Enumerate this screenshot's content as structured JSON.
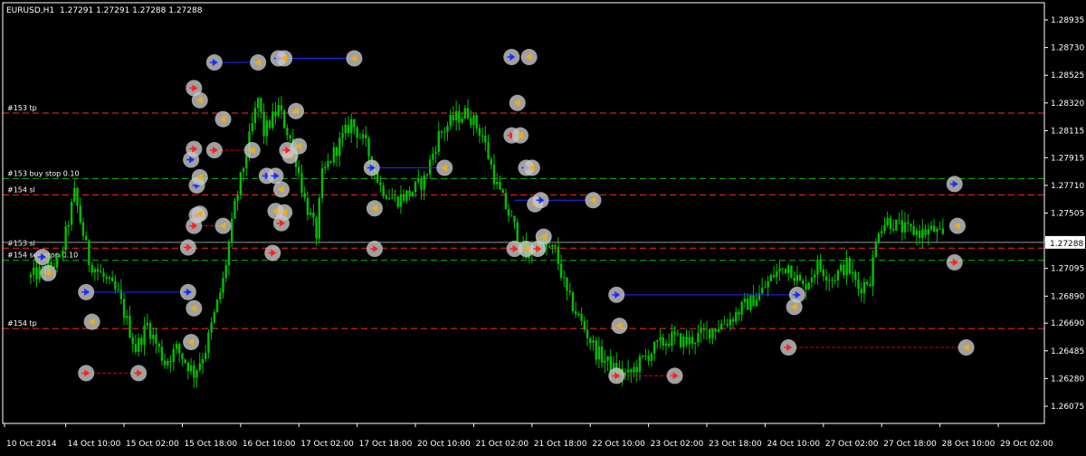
{
  "header": {
    "symbol": "EURUSD,H1",
    "ohlc": "1.27291 1.27291 1.27288 1.27288"
  },
  "colors": {
    "background": "#000000",
    "frame": "#ffffff",
    "grid": "#6b6b6b",
    "candle": "#00c000",
    "price_marker_bg": "#ffffff",
    "price_marker_text": "#000000",
    "buy_arrow": "#1a2cff",
    "sell_arrow": "#ff2020",
    "close_marker": "#e8b020",
    "marker_disc": "#c8c8c8",
    "buy_line": "#1a2cff",
    "sell_line": "#e00000",
    "level_red": "#ff2a2a",
    "level_green": "#00c000"
  },
  "chart_data": {
    "type": "candlestick",
    "timeframe": "H1",
    "y_axis": {
      "min": 1.26075,
      "max": 1.28975,
      "ticks": [
        1.26075,
        1.2628,
        1.26485,
        1.2669,
        1.2689,
        1.27095,
        1.27305,
        1.27505,
        1.2771,
        1.27915,
        1.28115,
        1.2832,
        1.28525,
        1.2873,
        1.28935
      ]
    },
    "x_axis": {
      "ticks": [
        "10 Oct 2014",
        "14 Oct 10:00",
        "15 Oct 02:00",
        "15 Oct 18:00",
        "16 Oct 10:00",
        "17 Oct 02:00",
        "17 Oct 18:00",
        "20 Oct 10:00",
        "21 Oct 02:00",
        "21 Oct 18:00",
        "22 Oct 10:00",
        "23 Oct 02:00",
        "23 Oct 18:00",
        "24 Oct 10:00",
        "27 Oct 02:00",
        "27 Oct 18:00",
        "28 Oct 10:00",
        "29 Oct 02:00"
      ]
    },
    "current_price": 1.27288,
    "price_path": [
      [
        0,
        1.2703
      ],
      [
        1,
        1.2715
      ],
      [
        1.5,
        1.2765
      ],
      [
        2,
        1.2715
      ],
      [
        3,
        1.269
      ],
      [
        3.6,
        1.265
      ],
      [
        4,
        1.2668
      ],
      [
        4.6,
        1.264
      ],
      [
        5,
        1.265
      ],
      [
        5.6,
        1.2632
      ],
      [
        6,
        1.265
      ],
      [
        6.6,
        1.27
      ],
      [
        7,
        1.2755
      ],
      [
        7.4,
        1.2795
      ],
      [
        7.8,
        1.2835
      ],
      [
        8,
        1.281
      ],
      [
        8.5,
        1.2828
      ],
      [
        9,
        1.28
      ],
      [
        9.4,
        1.276
      ],
      [
        9.8,
        1.2735
      ],
      [
        10,
        1.2778
      ],
      [
        10.4,
        1.2795
      ],
      [
        10.8,
        1.281
      ],
      [
        11,
        1.2818
      ],
      [
        11.5,
        1.28
      ],
      [
        12,
        1.277
      ],
      [
        12.5,
        1.276
      ],
      [
        13,
        1.2765
      ],
      [
        13.5,
        1.2775
      ],
      [
        14,
        1.2808
      ],
      [
        14.5,
        1.282
      ],
      [
        15,
        1.2825
      ],
      [
        15.5,
        1.2808
      ],
      [
        16,
        1.277
      ],
      [
        16.5,
        1.2745
      ],
      [
        17,
        1.2718
      ],
      [
        17.4,
        1.2728
      ],
      [
        18,
        1.2722
      ],
      [
        18.4,
        1.269
      ],
      [
        19,
        1.2665
      ],
      [
        19.4,
        1.2648
      ],
      [
        20,
        1.2635
      ],
      [
        20.5,
        1.263
      ],
      [
        21,
        1.2642
      ],
      [
        21.5,
        1.2652
      ],
      [
        22,
        1.2658
      ],
      [
        22.5,
        1.2655
      ],
      [
        23,
        1.266
      ],
      [
        23.5,
        1.2666
      ],
      [
        24,
        1.2672
      ],
      [
        24.5,
        1.2682
      ],
      [
        25,
        1.269
      ],
      [
        25.5,
        1.2705
      ],
      [
        26,
        1.2712
      ],
      [
        26.5,
        1.2695
      ],
      [
        27,
        1.2712
      ],
      [
        27.5,
        1.2702
      ],
      [
        28,
        1.2712
      ],
      [
        28.4,
        1.2695
      ],
      [
        28.8,
        1.2702
      ],
      [
        29.1,
        1.274
      ],
      [
        29.4,
        1.2745
      ],
      [
        30,
        1.2738
      ],
      [
        30.6,
        1.2736
      ],
      [
        31,
        1.2738
      ],
      [
        31.4,
        1.2729
      ]
    ],
    "levels": [
      {
        "label": "#153 tp",
        "price": 1.28245,
        "color": "red",
        "show_label": true
      },
      {
        "label": "#153 buy stop 0.10",
        "price": 1.2776,
        "color": "green",
        "show_label": true
      },
      {
        "label": "#154 sl",
        "price": 1.2764,
        "color": "red",
        "show_label": true
      },
      {
        "label": "#153 sl",
        "price": 1.27245,
        "color": "red",
        "show_label": true
      },
      {
        "label": "#154 sell stop 0.10",
        "price": 1.27155,
        "color": "green",
        "show_label": true
      },
      {
        "label": "#154 tp",
        "price": 1.2665,
        "color": "red",
        "show_label": true
      }
    ],
    "trades": [
      {
        "dir": "buy",
        "x1": 6.3,
        "y1": 1.2862,
        "x2": 7.8,
        "y2": 1.2862
      },
      {
        "dir": "buy",
        "x1": 8.5,
        "y1": 1.2865,
        "x2": 11.1,
        "y2": 1.2865
      },
      {
        "dir": "buy",
        "x1": 11.7,
        "y1": 1.2784,
        "x2": 14.2,
        "y2": 1.2784
      },
      {
        "dir": "buy",
        "x1": 16.6,
        "y1": 1.276,
        "x2": 19.3,
        "y2": 1.276
      },
      {
        "dir": "buy",
        "x1": 1.9,
        "y1": 1.2692,
        "x2": 5.4,
        "y2": 1.2692
      },
      {
        "dir": "buy",
        "x1": 20.1,
        "y1": 1.269,
        "x2": 26.3,
        "y2": 1.269
      },
      {
        "dir": "sell",
        "x1": 1.9,
        "y1": 1.2632,
        "x2": 3.7,
        "y2": 1.2632
      },
      {
        "dir": "sell",
        "x1": 20.1,
        "y1": 1.263,
        "x2": 22.1,
        "y2": 1.263
      },
      {
        "dir": "sell",
        "x1": 26.0,
        "y1": 1.2651,
        "x2": 32.1,
        "y2": 1.2651
      },
      {
        "dir": "sell",
        "x1": 6.3,
        "y1": 1.2797,
        "x2": 7.6,
        "y2": 1.2797
      },
      {
        "dir": "sell",
        "x1": 8.8,
        "y1": 1.2797,
        "x2": 9.2,
        "y2": 1.2797
      },
      {
        "dir": "sell",
        "x1": 5.6,
        "y1": 1.2741,
        "x2": 6.6,
        "y2": 1.2741
      },
      {
        "dir": "sell",
        "x1": 11.5,
        "y1": 1.2724,
        "x2": 11.8,
        "y2": 1.2724
      },
      {
        "dir": "sell",
        "x1": 16.5,
        "y1": 1.2724,
        "x2": 17.4,
        "y2": 1.2724
      }
    ],
    "markers": [
      {
        "x": 0.4,
        "y": 1.2718,
        "kind": "buy"
      },
      {
        "x": 0.6,
        "y": 1.2706,
        "kind": "close"
      },
      {
        "x": 1.9,
        "y": 1.2692,
        "kind": "buy"
      },
      {
        "x": 2.1,
        "y": 1.267,
        "kind": "close"
      },
      {
        "x": 1.9,
        "y": 1.2632,
        "kind": "sell"
      },
      {
        "x": 3.7,
        "y": 1.2632,
        "kind": "sell"
      },
      {
        "x": 5.4,
        "y": 1.2692,
        "kind": "buy"
      },
      {
        "x": 5.6,
        "y": 1.268,
        "kind": "close"
      },
      {
        "x": 5.5,
        "y": 1.2655,
        "kind": "close"
      },
      {
        "x": 5.4,
        "y": 1.2725,
        "kind": "sell"
      },
      {
        "x": 5.6,
        "y": 1.2741,
        "kind": "sell"
      },
      {
        "x": 5.7,
        "y": 1.2749,
        "kind": "sell"
      },
      {
        "x": 5.8,
        "y": 1.275,
        "kind": "close"
      },
      {
        "x": 6.6,
        "y": 1.2741,
        "kind": "close"
      },
      {
        "x": 5.5,
        "y": 1.279,
        "kind": "buy"
      },
      {
        "x": 5.6,
        "y": 1.2798,
        "kind": "sell"
      },
      {
        "x": 5.7,
        "y": 1.2771,
        "kind": "buy"
      },
      {
        "x": 5.8,
        "y": 1.2777,
        "kind": "close"
      },
      {
        "x": 5.6,
        "y": 1.2843,
        "kind": "sell"
      },
      {
        "x": 5.8,
        "y": 1.2834,
        "kind": "close"
      },
      {
        "x": 6.3,
        "y": 1.2862,
        "kind": "buy"
      },
      {
        "x": 7.8,
        "y": 1.2862,
        "kind": "close"
      },
      {
        "x": 6.3,
        "y": 1.2797,
        "kind": "sell"
      },
      {
        "x": 7.6,
        "y": 1.2797,
        "kind": "close"
      },
      {
        "x": 6.6,
        "y": 1.282,
        "kind": "close"
      },
      {
        "x": 8.1,
        "y": 1.2778,
        "kind": "buy"
      },
      {
        "x": 8.4,
        "y": 1.2778,
        "kind": "buy"
      },
      {
        "x": 8.6,
        "y": 1.2768,
        "kind": "close"
      },
      {
        "x": 8.7,
        "y": 1.2751,
        "kind": "close"
      },
      {
        "x": 8.4,
        "y": 1.2752,
        "kind": "close"
      },
      {
        "x": 8.6,
        "y": 1.2743,
        "kind": "sell"
      },
      {
        "x": 8.3,
        "y": 1.2721,
        "kind": "sell"
      },
      {
        "x": 8.9,
        "y": 1.2793,
        "kind": "close"
      },
      {
        "x": 8.8,
        "y": 1.2797,
        "kind": "sell"
      },
      {
        "x": 9.2,
        "y": 1.28,
        "kind": "close"
      },
      {
        "x": 9.1,
        "y": 1.2826,
        "kind": "close"
      },
      {
        "x": 8.5,
        "y": 1.2865,
        "kind": "buy"
      },
      {
        "x": 8.7,
        "y": 1.2865,
        "kind": "close"
      },
      {
        "x": 11.1,
        "y": 1.2865,
        "kind": "close"
      },
      {
        "x": 11.7,
        "y": 1.2784,
        "kind": "buy"
      },
      {
        "x": 14.2,
        "y": 1.2784,
        "kind": "close"
      },
      {
        "x": 11.8,
        "y": 1.2754,
        "kind": "close"
      },
      {
        "x": 11.8,
        "y": 1.2724,
        "kind": "sell"
      },
      {
        "x": 16.5,
        "y": 1.2866,
        "kind": "buy"
      },
      {
        "x": 17.1,
        "y": 1.2866,
        "kind": "close"
      },
      {
        "x": 16.7,
        "y": 1.2832,
        "kind": "close"
      },
      {
        "x": 16.5,
        "y": 1.2808,
        "kind": "sell"
      },
      {
        "x": 16.8,
        "y": 1.2808,
        "kind": "close"
      },
      {
        "x": 17.0,
        "y": 1.2784,
        "kind": "buy"
      },
      {
        "x": 17.2,
        "y": 1.2784,
        "kind": "close"
      },
      {
        "x": 17.3,
        "y": 1.2757,
        "kind": "close"
      },
      {
        "x": 17.5,
        "y": 1.276,
        "kind": "buy"
      },
      {
        "x": 17.6,
        "y": 1.2733,
        "kind": "close"
      },
      {
        "x": 16.6,
        "y": 1.2724,
        "kind": "sell"
      },
      {
        "x": 17.0,
        "y": 1.2724,
        "kind": "close"
      },
      {
        "x": 17.4,
        "y": 1.2724,
        "kind": "sell"
      },
      {
        "x": 19.3,
        "y": 1.276,
        "kind": "close"
      },
      {
        "x": 20.1,
        "y": 1.269,
        "kind": "buy"
      },
      {
        "x": 20.2,
        "y": 1.2667,
        "kind": "close"
      },
      {
        "x": 20.1,
        "y": 1.263,
        "kind": "sell"
      },
      {
        "x": 22.1,
        "y": 1.263,
        "kind": "sell"
      },
      {
        "x": 26.0,
        "y": 1.2651,
        "kind": "sell"
      },
      {
        "x": 26.2,
        "y": 1.2681,
        "kind": "close"
      },
      {
        "x": 26.3,
        "y": 1.269,
        "kind": "buy"
      },
      {
        "x": 31.7,
        "y": 1.2772,
        "kind": "buy"
      },
      {
        "x": 31.8,
        "y": 1.2741,
        "kind": "close"
      },
      {
        "x": 31.7,
        "y": 1.2714,
        "kind": "sell"
      },
      {
        "x": 32.1,
        "y": 1.2651,
        "kind": "close"
      }
    ]
  }
}
